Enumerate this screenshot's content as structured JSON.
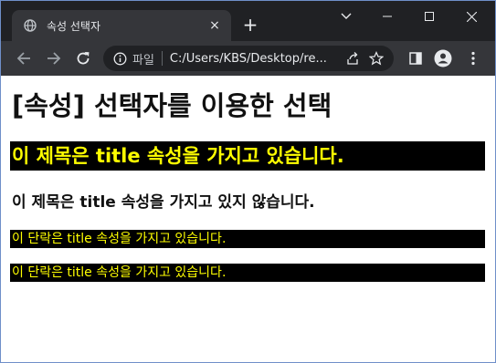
{
  "browser": {
    "tab": {
      "title": "속성 선택자",
      "favicon": "globe-icon",
      "close": "×"
    },
    "new_tab": "+",
    "window_controls": [
      "chevron-down-icon",
      "minimize-icon",
      "maximize-icon",
      "close-icon"
    ],
    "address_bar": {
      "scheme_label": "파일",
      "url": "C:/Users/KBS/Desktop/re..."
    },
    "colors": {
      "frame": "#202124",
      "toolbar": "#35363a",
      "text": "#e8eaed"
    }
  },
  "page": {
    "heading": "[속성] 선택자를 이용한 선택",
    "titled_heading": "이 제목은 title 속성을 가지고 있습니다.",
    "plain_heading": "이 제목은 title 속성을 가지고 있지 않습니다.",
    "paragraphs": [
      "이 단락은 title 속성을 가지고 있습니다.",
      "이 단락은 title 속성을 가지고 있습니다."
    ],
    "colors": {
      "highlight_bg": "#000000",
      "highlight_text": "#ffff00"
    }
  }
}
